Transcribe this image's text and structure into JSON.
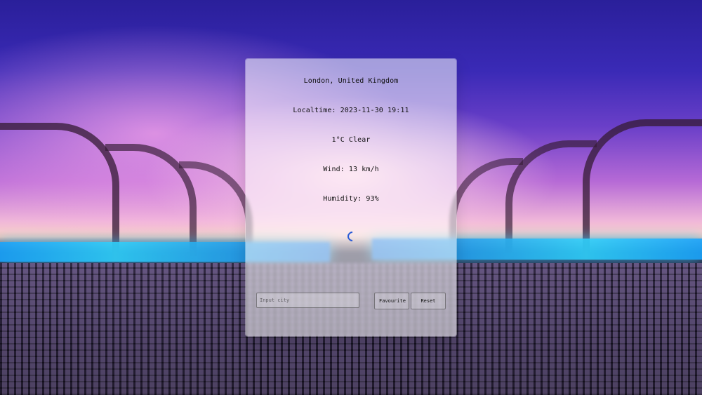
{
  "weather": {
    "location": "London, United Kingdom",
    "localtime": "Localtime: 2023-11-30 19:11",
    "condition": "1°C Clear",
    "wind": "Wind: 13 km/h",
    "humidity": "Humidity: 93%"
  },
  "controls": {
    "city_input_placeholder": "Input city",
    "city_input_value": "",
    "favourite_label": "Favourite",
    "reset_label": "Reset"
  },
  "icons": {
    "loading": "loading-spinner-icon"
  },
  "colors": {
    "spinner_accent": "#2a5bd7"
  }
}
